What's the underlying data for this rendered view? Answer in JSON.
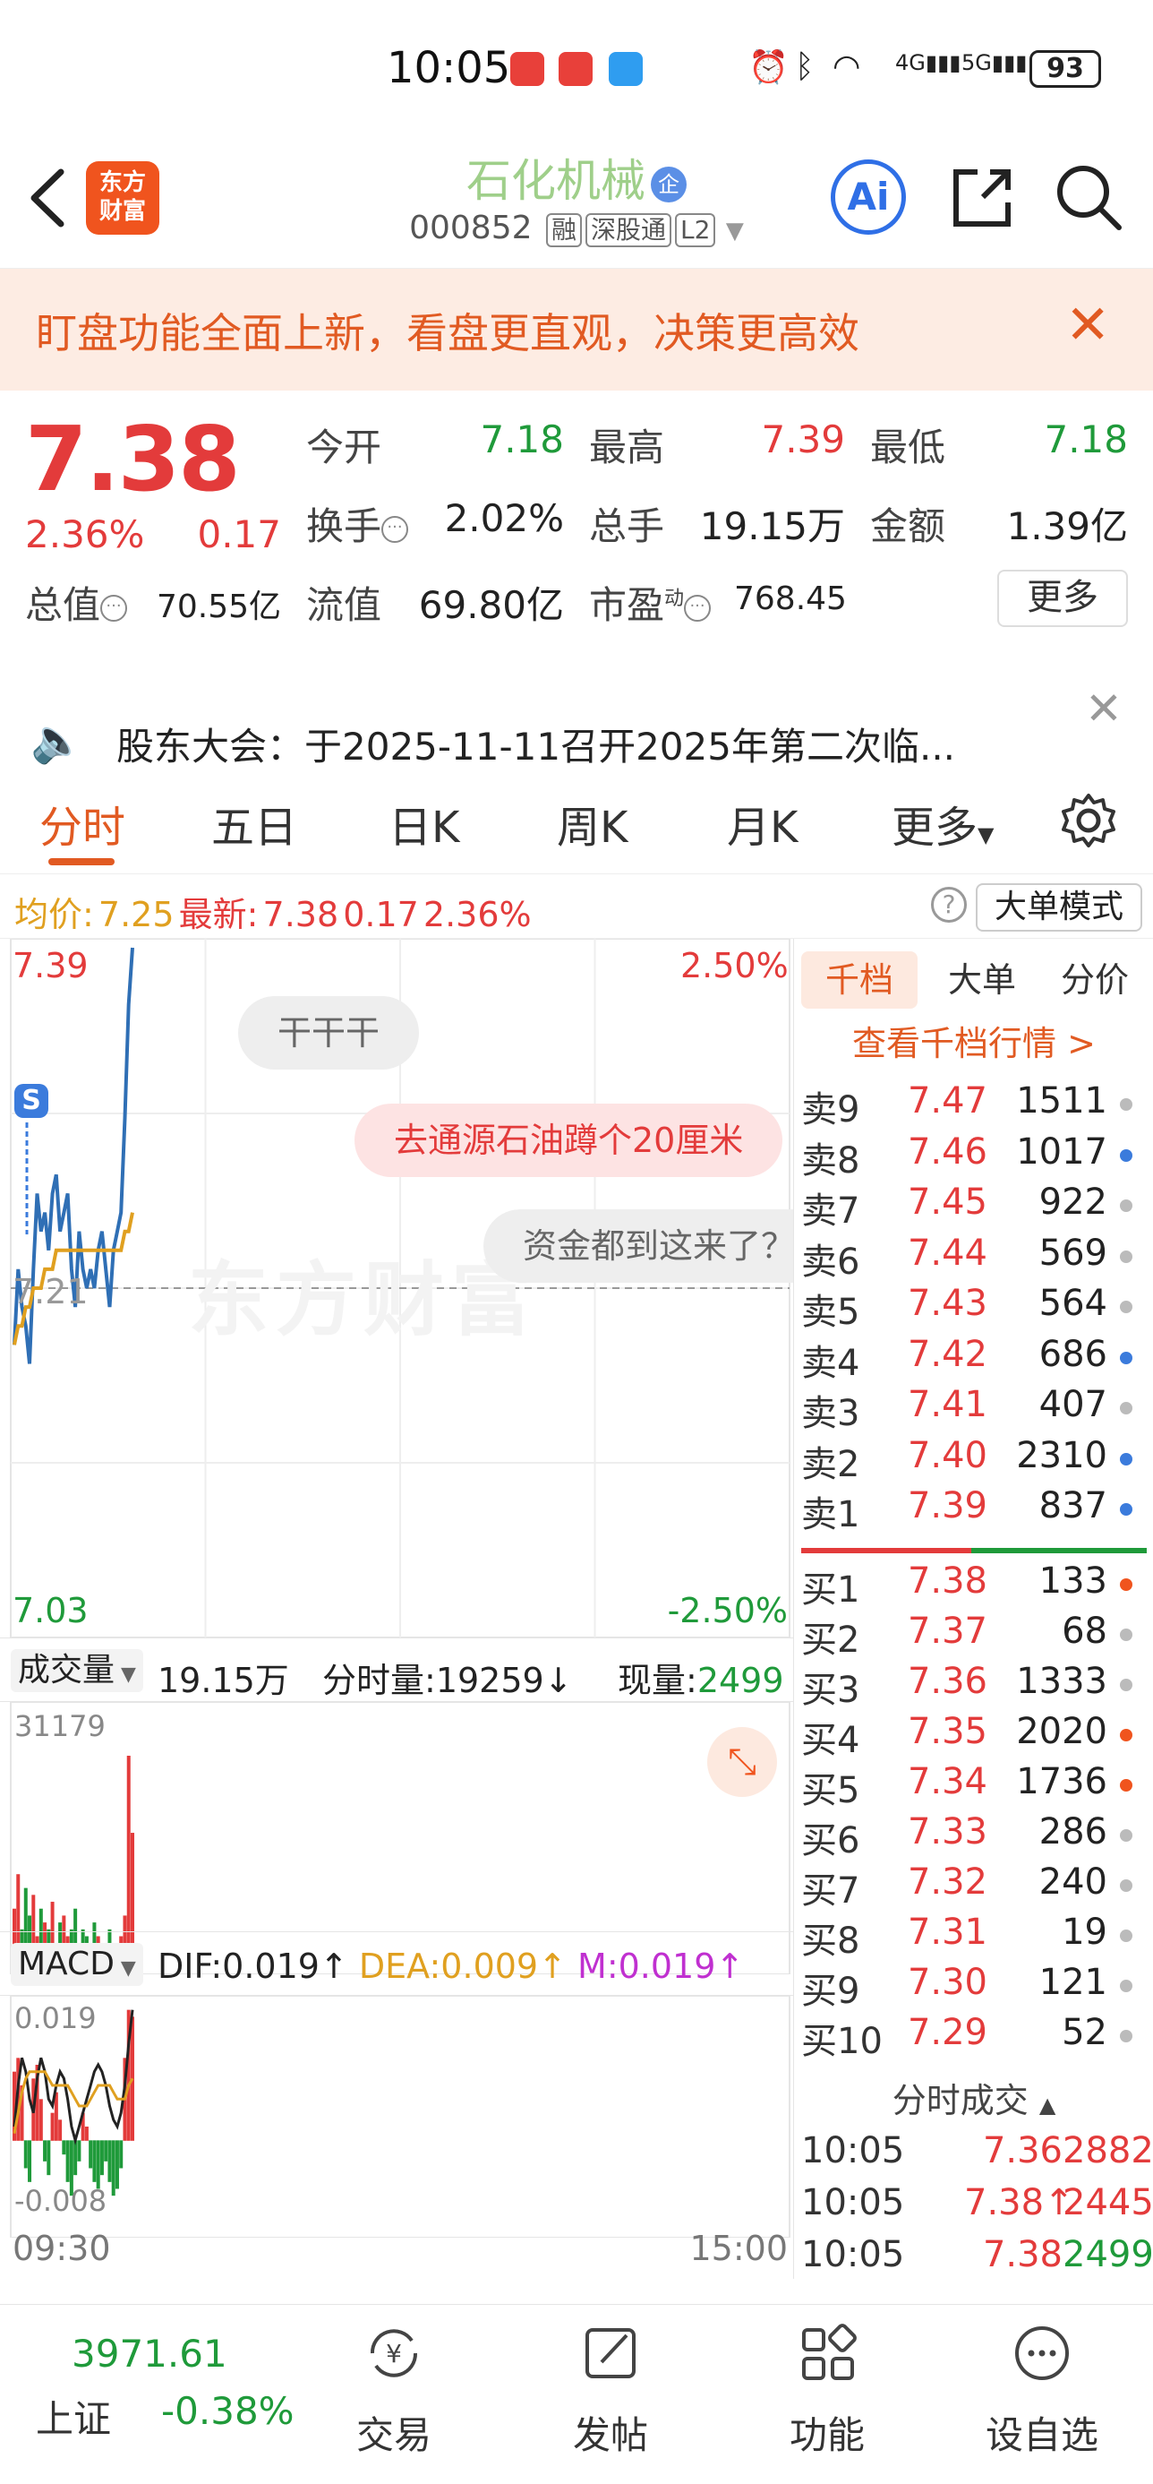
{
  "status_bar": {
    "time": "10:05",
    "signal_4g": "4G",
    "signal_5g": "5G",
    "battery": "93"
  },
  "header": {
    "stock_name": "石化机械",
    "qi_badge": "企",
    "stock_code": "000852",
    "tags": [
      "融",
      "深股通",
      "L2"
    ],
    "ai_label": "Ai"
  },
  "banner": {
    "text": "盯盘功能全面上新，看盘更直观，决策更高效"
  },
  "quote": {
    "price": "7.38",
    "change_pct": "2.36%",
    "change": "0.17",
    "open_label": "今开",
    "open": "7.18",
    "high_label": "最高",
    "high": "7.39",
    "low_label": "最低",
    "low": "7.18",
    "turnover_label": "换手",
    "turnover": "2.02%",
    "volume_label": "总手",
    "volume": "19.15万",
    "amount_label": "金额",
    "amount": "1.39亿",
    "mktcap_label": "总值",
    "mktcap": "70.55亿",
    "float_label": "流值",
    "float": "69.80亿",
    "pe_label": "市盈",
    "pe_sup": "动",
    "pe": "768.45",
    "more_label": "更多"
  },
  "notice": {
    "text": "股东大会：于2025-11-11召开2025年第二次临..."
  },
  "tabs": [
    "分时",
    "五日",
    "日K",
    "周K",
    "月K",
    "更多"
  ],
  "avg_row": {
    "avg_label": "均价:",
    "avg": "7.25",
    "latest_label": "最新:",
    "latest": "7.38",
    "chg": "0.17",
    "pct": "2.36%",
    "help": "?",
    "big_order_btn": "大单模式"
  },
  "chart": {
    "price_top": "7.39",
    "pct_top": "2.50%",
    "price_bottom": "7.03",
    "pct_bottom": "-2.50%",
    "ref_price": "7.21",
    "s_badge": "S",
    "watermark": "东方财富",
    "bubbles": [
      "干干干",
      "去通源石油蹲个20厘米",
      "资金都到这来了？"
    ],
    "volume_row": {
      "label": "成交量",
      "total": "19.15万",
      "tick_label": "分时量:",
      "tick": "19259",
      "now_label": "现量:",
      "now": "2499"
    },
    "vol_max": "31179",
    "macd_row": {
      "label": "MACD",
      "dif": "DIF:0.019",
      "dea": "DEA:0.009",
      "m": "M:0.019"
    },
    "macd_top": "0.019",
    "macd_bottom": "-0.008",
    "time_start": "09:30",
    "time_end": "15:00"
  },
  "chart_data": {
    "type": "line",
    "title": "",
    "xlabel": "",
    "ylabel": "",
    "ylim": [
      7.03,
      7.39
    ],
    "ref": 7.21,
    "series": [
      {
        "values": [
          7.18,
          7.22,
          7.2,
          7.19,
          7.17,
          7.22,
          7.26,
          7.24,
          7.25,
          7.23,
          7.26,
          7.27,
          7.24,
          7.25,
          7.26,
          7.22,
          7.2,
          7.24,
          7.22,
          7.21,
          7.22,
          7.21,
          7.23,
          7.24,
          7.22,
          7.2,
          7.23,
          7.24,
          7.25,
          7.3,
          7.36,
          7.39
        ]
      },
      {
        "values": [
          7.18,
          7.19,
          7.19,
          7.2,
          7.2,
          7.21,
          7.21,
          7.21,
          7.22,
          7.22,
          7.22,
          7.23,
          7.23,
          7.23,
          7.23,
          7.23,
          7.23,
          7.23,
          7.23,
          7.23,
          7.23,
          7.23,
          7.23,
          7.23,
          7.23,
          7.23,
          7.23,
          7.23,
          7.23,
          7.24,
          7.24,
          7.25
        ]
      }
    ],
    "volume": [
      9000,
      14000,
      6000,
      12000,
      8000,
      11000,
      5000,
      9000,
      7000,
      6000,
      10000,
      4000,
      7000,
      8000,
      5000,
      6000,
      9000,
      4000,
      6000,
      5000,
      4000,
      7000,
      5000,
      3000,
      4000,
      6000,
      4000,
      3000,
      5000,
      8000,
      31179,
      20000
    ],
    "macd_hist": [
      0.01,
      0.012,
      0.008,
      -0.004,
      -0.006,
      0.009,
      0.011,
      0.006,
      -0.003,
      -0.005,
      0.004,
      0.007,
      0.003,
      -0.002,
      -0.006,
      -0.008,
      -0.005,
      -0.003,
      0.004,
      0.002,
      -0.004,
      -0.006,
      -0.007,
      -0.005,
      -0.003,
      -0.006,
      -0.008,
      -0.007,
      -0.004,
      0.012,
      0.019,
      0.018
    ],
    "dif": [
      0.002,
      0.008,
      0.012,
      0.01,
      0.006,
      0.004,
      0.009,
      0.012,
      0.01,
      0.006,
      0.005,
      0.008,
      0.01,
      0.009,
      0.006,
      0.002,
      0.0,
      0.002,
      0.004,
      0.006,
      0.008,
      0.01,
      0.011,
      0.01,
      0.008,
      0.005,
      0.003,
      0.002,
      0.004,
      0.008,
      0.014,
      0.019
    ],
    "dea": [
      0.001,
      0.004,
      0.007,
      0.009,
      0.01,
      0.01,
      0.01,
      0.01,
      0.01,
      0.009,
      0.008,
      0.008,
      0.008,
      0.008,
      0.008,
      0.007,
      0.006,
      0.005,
      0.005,
      0.005,
      0.006,
      0.007,
      0.008,
      0.008,
      0.008,
      0.008,
      0.007,
      0.006,
      0.006,
      0.006,
      0.008,
      0.009
    ]
  },
  "orderbook": {
    "tabs": [
      "千档",
      "大单",
      "分价"
    ],
    "link": "查看千档行情 >",
    "sells": [
      {
        "label": "卖9",
        "price": "7.47",
        "vol": "1511",
        "dot": "#bbbbbb"
      },
      {
        "label": "卖8",
        "price": "7.46",
        "vol": "1017",
        "dot": "#3b7bdc"
      },
      {
        "label": "卖7",
        "price": "7.45",
        "vol": "922",
        "dot": "#bbbbbb"
      },
      {
        "label": "卖6",
        "price": "7.44",
        "vol": "569",
        "dot": "#bbbbbb"
      },
      {
        "label": "卖5",
        "price": "7.43",
        "vol": "564",
        "dot": "#bbbbbb"
      },
      {
        "label": "卖4",
        "price": "7.42",
        "vol": "686",
        "dot": "#3b7bdc"
      },
      {
        "label": "卖3",
        "price": "7.41",
        "vol": "407",
        "dot": "#bbbbbb"
      },
      {
        "label": "卖2",
        "price": "7.40",
        "vol": "2310",
        "dot": "#3b7bdc"
      },
      {
        "label": "卖1",
        "price": "7.39",
        "vol": "837",
        "dot": "#3b7bdc"
      }
    ],
    "buys": [
      {
        "label": "买1",
        "price": "7.38",
        "vol": "133",
        "dot": "#f0541e"
      },
      {
        "label": "买2",
        "price": "7.37",
        "vol": "68",
        "dot": "#bbbbbb"
      },
      {
        "label": "买3",
        "price": "7.36",
        "vol": "1333",
        "dot": "#bbbbbb"
      },
      {
        "label": "买4",
        "price": "7.35",
        "vol": "2020",
        "dot": "#f0541e"
      },
      {
        "label": "买5",
        "price": "7.34",
        "vol": "1736",
        "dot": "#f0541e"
      },
      {
        "label": "买6",
        "price": "7.33",
        "vol": "286",
        "dot": "#bbbbbb"
      },
      {
        "label": "买7",
        "price": "7.32",
        "vol": "240",
        "dot": "#bbbbbb"
      },
      {
        "label": "买8",
        "price": "7.31",
        "vol": "19",
        "dot": "#bbbbbb"
      },
      {
        "label": "买9",
        "price": "7.30",
        "vol": "121",
        "dot": "#bbbbbb"
      },
      {
        "label": "买10",
        "price": "7.29",
        "vol": "52",
        "dot": "#bbbbbb"
      }
    ],
    "trades_title": "分时成交",
    "trades": [
      {
        "time": "10:05",
        "price": "7.36",
        "vol": "2882",
        "vol_color": "#e33b3b"
      },
      {
        "time": "10:05",
        "price": "7.38↑",
        "vol": "2445",
        "vol_color": "#e33b3b"
      },
      {
        "time": "10:05",
        "price": "7.38",
        "vol": "2499",
        "vol_color": "#1f9a3a"
      }
    ]
  },
  "bottom_nav": {
    "index_value": "3971.61",
    "index_name": "上证",
    "index_pct": "-0.38%",
    "items": [
      "交易",
      "发帖",
      "功能",
      "设自选"
    ],
    "trade_icon_glyph": "¥"
  }
}
